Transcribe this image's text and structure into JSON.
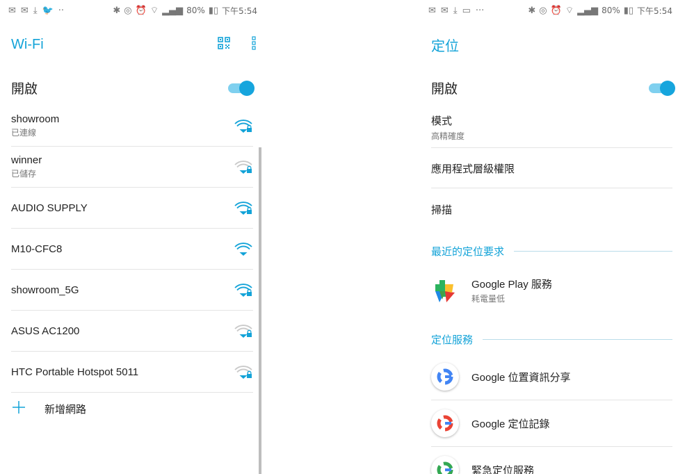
{
  "colors": {
    "accent": "#13a3d8",
    "toggle_track": "#7fd0ef",
    "toggle_thumb": "#16a5dd"
  },
  "wifi_screen": {
    "status_bar": {
      "battery": "80%",
      "time": "下午5:54"
    },
    "title": "Wi-Fi",
    "toggle": {
      "label": "開啟",
      "on": true
    },
    "networks": [
      {
        "name": "showroom",
        "status": "已連線",
        "secured": true,
        "strength": "strong"
      },
      {
        "name": "winner",
        "status": "已儲存",
        "secured": true,
        "strength": "weak"
      },
      {
        "name": "AUDIO SUPPLY",
        "status": "",
        "secured": true,
        "strength": "strong"
      },
      {
        "name": "M10-CFC8",
        "status": "",
        "secured": false,
        "strength": "strong"
      },
      {
        "name": "showroom_5G",
        "status": "",
        "secured": true,
        "strength": "strong"
      },
      {
        "name": "ASUS AC1200",
        "status": "",
        "secured": true,
        "strength": "weak"
      },
      {
        "name": "HTC Portable Hotspot 5011",
        "status": "",
        "secured": true,
        "strength": "weak"
      }
    ],
    "add_network": "新增網路",
    "icons": [
      "qr-scan-icon",
      "more-vert-icon",
      "wifi-signal-icon",
      "add-icon"
    ]
  },
  "location_screen": {
    "status_bar": {
      "battery": "80%",
      "time": "下午5:54"
    },
    "title": "定位",
    "toggle": {
      "label": "開啟",
      "on": true
    },
    "mode": {
      "title": "模式",
      "value": "高精確度"
    },
    "app_permissions": "應用程式層級權限",
    "scanning": "掃描",
    "recent_requests": {
      "header": "最近的定位要求",
      "items": [
        {
          "name": "Google Play 服務",
          "sub": "耗電量低"
        }
      ]
    },
    "location_services": {
      "header": "定位服務",
      "items": [
        {
          "name": "Google 位置資訊分享"
        },
        {
          "name": "Google 定位記錄"
        },
        {
          "name": "緊急定位服務"
        }
      ]
    }
  }
}
